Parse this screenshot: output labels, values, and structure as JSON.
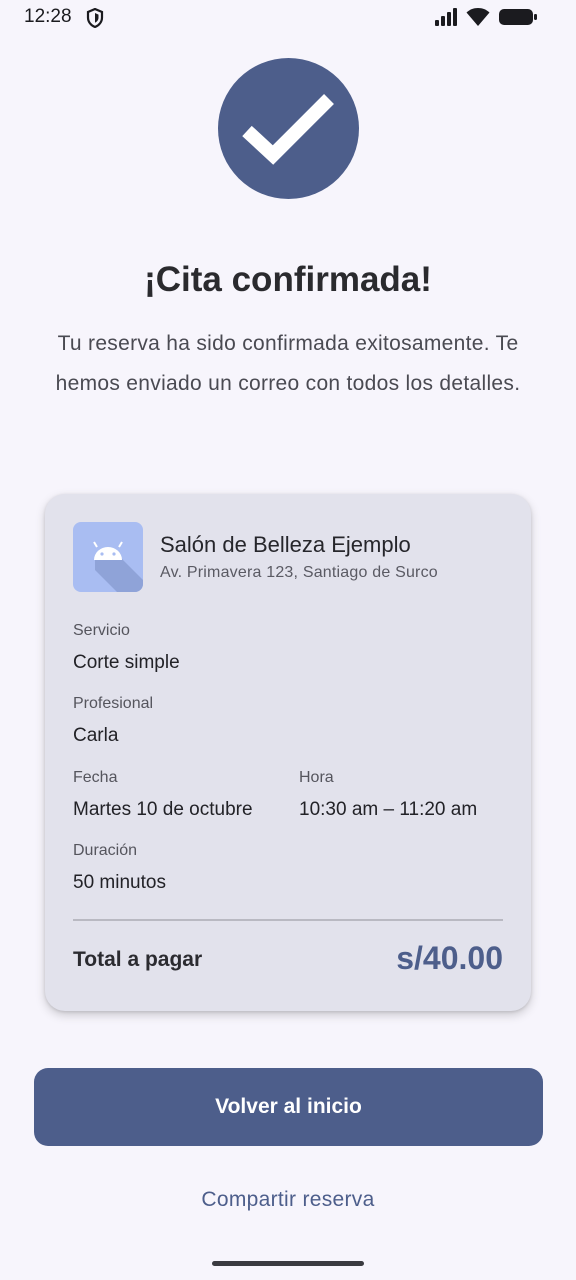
{
  "status_bar": {
    "time": "12:28"
  },
  "confirmation": {
    "title": "¡Cita confirmada!",
    "message": "Tu reserva ha sido confirmada exitosamente. Te hemos enviado un correo con todos los detalles."
  },
  "salon": {
    "name": "Salón de Belleza Ejemplo",
    "address": "Av. Primavera 123, Santiago de Surco"
  },
  "details": {
    "service_label": "Servicio",
    "service_value": "Corte simple",
    "professional_label": "Profesional",
    "professional_value": "Carla",
    "date_label": "Fecha",
    "date_value": "Martes 10 de octubre",
    "time_label": "Hora",
    "time_value": "10:30 am – 11:20 am",
    "duration_label": "Duración",
    "duration_value": "50 minutos"
  },
  "total": {
    "label": "Total a pagar",
    "value": "s/40.00"
  },
  "actions": {
    "primary_label": "Volver al inicio",
    "share_label": "Compartir reserva"
  },
  "colors": {
    "accent": "#4d5e8b",
    "card_background": "#e2e2ec",
    "page_background": "#f7f5fc",
    "logo_background": "#a9bdf2"
  },
  "icons": {
    "status": [
      "shield-icon",
      "signal-icon",
      "wifi-icon",
      "battery-icon"
    ],
    "hero": "checkmark-icon",
    "salon_logo": "android-icon"
  }
}
